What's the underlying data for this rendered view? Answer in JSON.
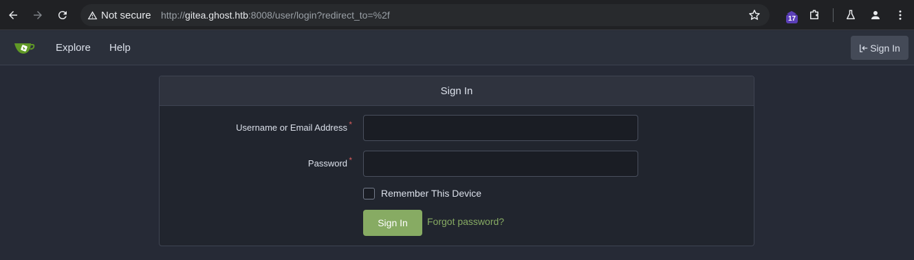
{
  "browser": {
    "security_label": "Not secure",
    "url_scheme": "http://",
    "url_host": "gitea.ghost.htb",
    "url_rest": ":8008/user/login?redirect_to=%2f",
    "extension_badge": "17"
  },
  "nav": {
    "explore_label": "Explore",
    "help_label": "Help",
    "signin_label": "Sign In"
  },
  "login": {
    "title": "Sign In",
    "username_label": "Username or Email Address",
    "password_label": "Password",
    "required_mark": "*",
    "username_value": "",
    "password_value": "",
    "remember_label": "Remember This Device",
    "submit_label": "Sign In",
    "forgot_label": "Forgot password?"
  },
  "colors": {
    "accent": "#87ab63",
    "required": "#d95c5c",
    "background": "#262a36"
  }
}
